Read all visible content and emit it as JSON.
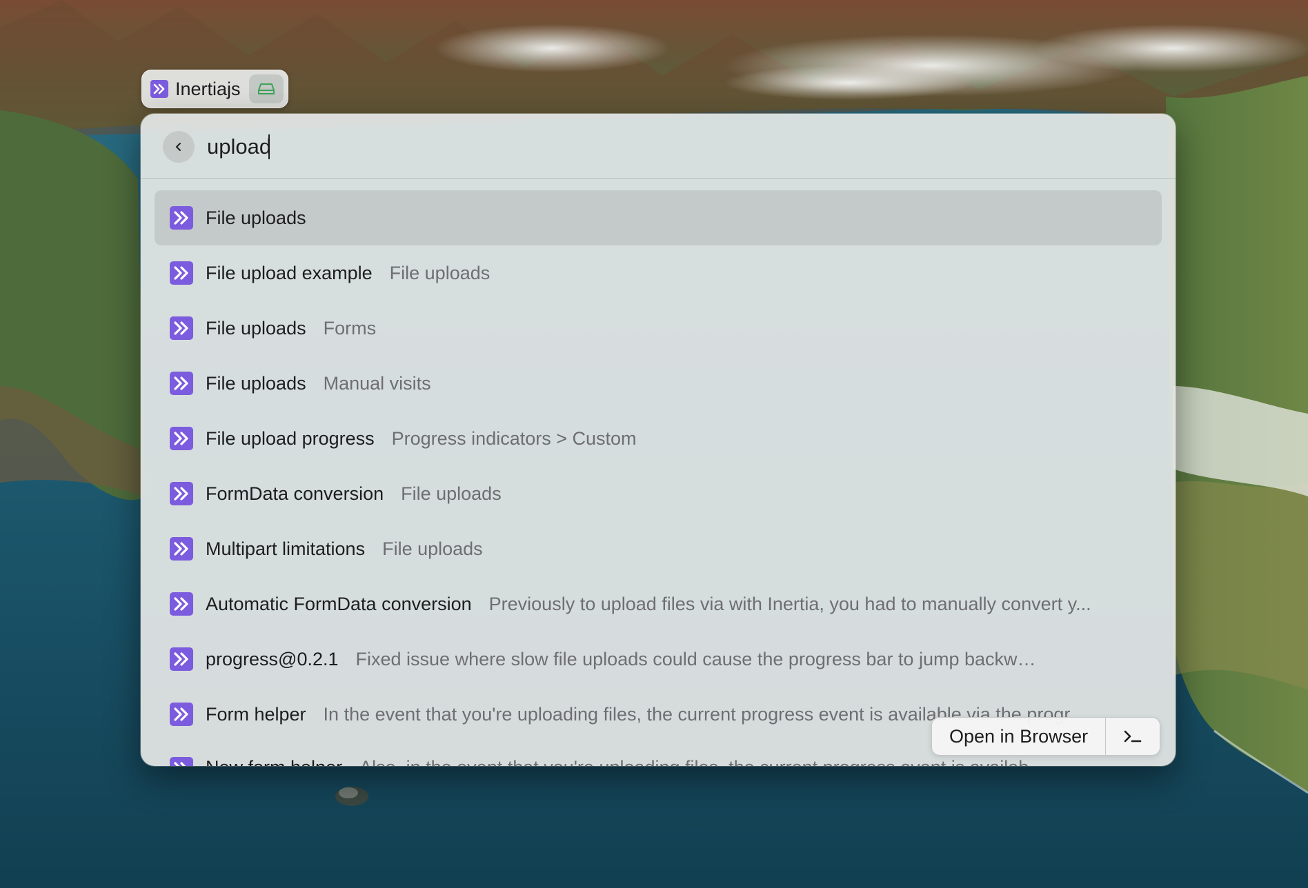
{
  "source": {
    "label": "Inertiajs",
    "icon": "inertia-logo-icon",
    "keyword_icon": "keyword-hard-drive-icon"
  },
  "search": {
    "value": "upload",
    "placeholder": "",
    "back_icon": "chevron-left-icon"
  },
  "results": [
    {
      "title": "File uploads",
      "subtitle": "",
      "selected": true
    },
    {
      "title": "File upload example",
      "subtitle": "File uploads"
    },
    {
      "title": "File uploads",
      "subtitle": "Forms"
    },
    {
      "title": "File uploads",
      "subtitle": "Manual visits"
    },
    {
      "title": "File upload progress",
      "subtitle": "Progress indicators > Custom"
    },
    {
      "title": "FormData conversion",
      "subtitle": "File uploads"
    },
    {
      "title": "Multipart limitations",
      "subtitle": "File uploads"
    },
    {
      "title": "Automatic FormData conversion",
      "subtitle": "Previously to upload files via with Inertia, you had to manually convert y..."
    },
    {
      "title": "progress@0.2.1",
      "subtitle": "Fixed issue where slow file uploads could cause the progress bar to jump backwards ( co..."
    },
    {
      "title": "Form helper",
      "subtitle": "In the event that you're uploading files, the current progress event is available via the progr"
    },
    {
      "title": "New form helper",
      "subtitle": "Also, in the event that you're uploading files, the current progress event is available at"
    }
  ],
  "actions": {
    "primary_label": "Open in Browser",
    "secondary_icon": "terminal-prompt-icon"
  },
  "colors": {
    "accent": "#7c5cde",
    "panel_bg": "#e2e6e4",
    "selected_row": "#c7cbca",
    "subtitle_text": "#6e6e72"
  }
}
